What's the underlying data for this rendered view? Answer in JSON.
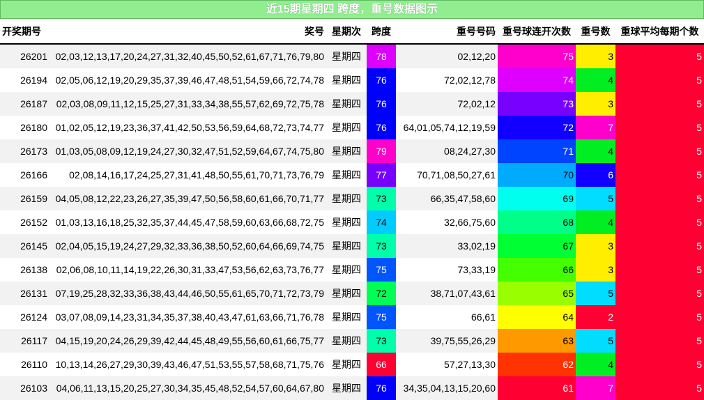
{
  "title": "近15期星期四 跨度，重号数据图示",
  "headers": [
    "开奖期号",
    "奖号",
    "星期次",
    "跨度",
    "重号号码",
    "重号球连开次数",
    "重号数",
    "重球平均每期个数"
  ],
  "rows": [
    {
      "period": "26201",
      "numbers": "02,03,12,13,17,20,24,27,31,32,40,45,50,52,61,67,71,76,79,80",
      "weekday": "星期四",
      "span": "78",
      "span_color": "#dd00ff",
      "repeat": "02,12,20",
      "streak": "75",
      "streak_color": "#ff00cc",
      "count": "3",
      "count_color": "#ffee00",
      "avg": "5",
      "avg_color": "#ff0033"
    },
    {
      "period": "26194",
      "numbers": "02,05,06,12,19,20,29,35,37,39,46,47,48,51,54,59,66,72,74,78",
      "weekday": "星期四",
      "span": "76",
      "span_color": "#0000ff",
      "repeat": "72,02,12,78",
      "streak": "74",
      "streak_color": "#dd00ff",
      "count": "4",
      "count_color": "#00ee22",
      "avg": "5",
      "avg_color": "#ff0033"
    },
    {
      "period": "26187",
      "numbers": "02,03,08,09,11,12,15,25,27,31,33,34,38,55,57,62,69,72,75,78",
      "weekday": "星期四",
      "span": "76",
      "span_color": "#0000ff",
      "repeat": "72,02,12",
      "streak": "73",
      "streak_color": "#7700ff",
      "count": "3",
      "count_color": "#ffee00",
      "avg": "5",
      "avg_color": "#ff0033"
    },
    {
      "period": "26180",
      "numbers": "01,02,05,12,19,23,36,37,41,42,50,53,56,59,64,68,72,73,74,77",
      "weekday": "星期四",
      "span": "76",
      "span_color": "#0000ff",
      "repeat": "64,01,05,74,12,19,59",
      "streak": "72",
      "streak_color": "#1100ff",
      "count": "7",
      "count_color": "#ff00cc",
      "avg": "5",
      "avg_color": "#ff0033"
    },
    {
      "period": "26173",
      "numbers": "01,03,05,08,09,12,19,24,27,30,32,47,51,52,59,64,67,74,75,80",
      "weekday": "星期四",
      "span": "79",
      "span_color": "#ff00cc",
      "repeat": "08,24,27,30",
      "streak": "71",
      "streak_color": "#0044ff",
      "count": "4",
      "count_color": "#00ee22",
      "avg": "5",
      "avg_color": "#ff0033"
    },
    {
      "period": "26166",
      "numbers": "02,08,14,16,17,24,25,27,31,41,48,50,55,61,70,71,73,76,79",
      "weekday": "星期四",
      "span": "77",
      "span_color": "#7700ff",
      "repeat": "70,71,08,50,27,61",
      "streak": "70",
      "streak_color": "#00aaff",
      "count": "6",
      "count_color": "#1100ff",
      "avg": "5",
      "avg_color": "#ff0033"
    },
    {
      "period": "26159",
      "numbers": "04,05,08,12,22,23,26,27,35,39,47,50,56,58,60,61,66,70,71,77",
      "weekday": "星期四",
      "span": "73",
      "span_color": "#00ffaa",
      "repeat": "66,35,47,58,60",
      "streak": "69",
      "streak_color": "#00ffee",
      "count": "5",
      "count_color": "#00ddff",
      "avg": "5",
      "avg_color": "#ff0033"
    },
    {
      "period": "26152",
      "numbers": "01,03,13,16,18,25,32,35,37,44,45,47,58,59,60,63,66,68,72,75",
      "weekday": "星期四",
      "span": "74",
      "span_color": "#00ccff",
      "repeat": "32,66,75,60",
      "streak": "68",
      "streak_color": "#00ff88",
      "count": "4",
      "count_color": "#00ee22",
      "avg": "5",
      "avg_color": "#ff0033"
    },
    {
      "period": "26145",
      "numbers": "02,04,05,15,19,24,27,29,32,33,36,38,50,52,60,64,66,69,74,75",
      "weekday": "星期四",
      "span": "73",
      "span_color": "#00ffaa",
      "repeat": "33,02,19",
      "streak": "67",
      "streak_color": "#00ff33",
      "count": "3",
      "count_color": "#ffee00",
      "avg": "5",
      "avg_color": "#ff0033"
    },
    {
      "period": "26138",
      "numbers": "02,06,08,10,11,14,19,22,26,30,31,33,47,53,56,62,63,73,76,77",
      "weekday": "星期四",
      "span": "75",
      "span_color": "#0055ff",
      "repeat": "73,33,19",
      "streak": "66",
      "streak_color": "#44ff00",
      "count": "3",
      "count_color": "#ffee00",
      "avg": "5",
      "avg_color": "#ff0033"
    },
    {
      "period": "26131",
      "numbers": "07,19,25,28,32,33,36,38,43,44,46,50,55,61,65,70,71,72,73,79",
      "weekday": "星期四",
      "span": "72",
      "span_color": "#00ff55",
      "repeat": "38,71,07,43,61",
      "streak": "65",
      "streak_color": "#99ff00",
      "count": "5",
      "count_color": "#00ddff",
      "avg": "5",
      "avg_color": "#ff0033"
    },
    {
      "period": "26124",
      "numbers": "03,07,08,09,14,23,31,34,35,37,38,40,43,47,61,63,66,71,76,78",
      "weekday": "星期四",
      "span": "75",
      "span_color": "#0055ff",
      "repeat": "66,61",
      "streak": "64",
      "streak_color": "#ffff00",
      "count": "2",
      "count_color": "#ff0033",
      "avg": "5",
      "avg_color": "#ff0033"
    },
    {
      "period": "26117",
      "numbers": "04,15,19,20,24,26,29,39,42,44,45,48,49,55,56,60,61,66,75,77",
      "weekday": "星期四",
      "span": "73",
      "span_color": "#00ffaa",
      "repeat": "39,75,55,26,29",
      "streak": "63",
      "streak_color": "#ff9900",
      "count": "5",
      "count_color": "#00ddff",
      "avg": "5",
      "avg_color": "#ff0033"
    },
    {
      "period": "26110",
      "numbers": "10,13,14,26,27,29,30,39,43,46,47,51,53,55,57,58,68,71,75,76",
      "weekday": "星期四",
      "span": "66",
      "span_color": "#ff0033",
      "repeat": "57,27,13,30",
      "streak": "62",
      "streak_color": "#ff3300",
      "count": "4",
      "count_color": "#00ee22",
      "avg": "5",
      "avg_color": "#ff0033"
    },
    {
      "period": "26103",
      "numbers": "04,06,11,13,15,20,25,27,30,34,35,45,48,52,54,57,60,64,67,80",
      "weekday": "星期四",
      "span": "76",
      "span_color": "#0000ff",
      "repeat": "34,35,04,13,15,20,60",
      "streak": "61",
      "streak_color": "#ff0033",
      "count": "7",
      "count_color": "#ff00cc",
      "avg": "5",
      "avg_color": "#ff0033"
    }
  ]
}
